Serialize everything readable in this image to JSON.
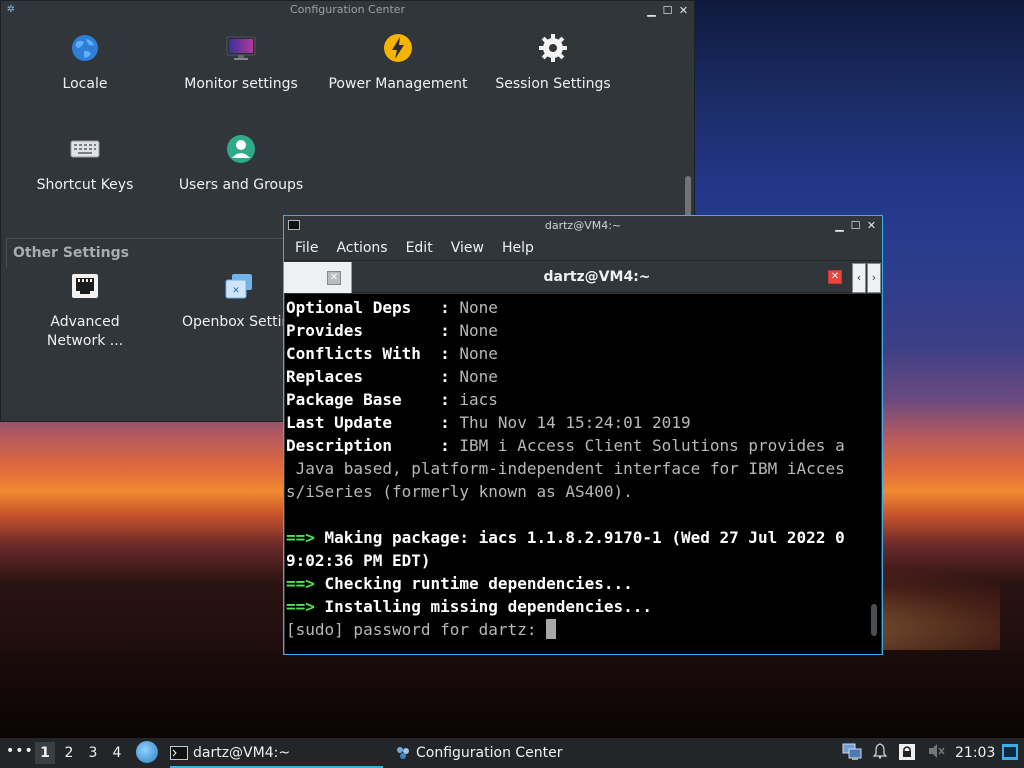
{
  "config_center": {
    "title": "Configuration Center",
    "items": [
      {
        "label": "Locale",
        "icon": "globe-icon"
      },
      {
        "label": "Monitor settings",
        "icon": "monitor-icon"
      },
      {
        "label": "Power Management",
        "icon": "power-icon"
      },
      {
        "label": "Session Settings",
        "icon": "gear-icon"
      },
      {
        "label": "Shortcut Keys",
        "icon": "keyboard-icon"
      },
      {
        "label": "Users and Groups",
        "icon": "user-icon"
      }
    ],
    "other_section_title": "Other Settings",
    "other_items": [
      {
        "label": "Advanced\nNetwork ...",
        "icon": "network-icon"
      },
      {
        "label": "Openbox Settin",
        "icon": "openbox-icon"
      }
    ]
  },
  "terminal": {
    "title": "dartz@VM4:~",
    "menus": [
      "File",
      "Actions",
      "Edit",
      "View",
      "Help"
    ],
    "tab_title": "dartz@VM4:~",
    "lines": [
      {
        "key": "Optional Deps   ",
        "sep": ": ",
        "value": "None"
      },
      {
        "key": "Provides        ",
        "sep": ": ",
        "value": "None"
      },
      {
        "key": "Conflicts With  ",
        "sep": ": ",
        "value": "None"
      },
      {
        "key": "Replaces        ",
        "sep": ": ",
        "value": "None"
      },
      {
        "key": "Package Base    ",
        "sep": ": ",
        "value": "iacs"
      },
      {
        "key": "Last Update     ",
        "sep": ": ",
        "value": "Thu Nov 14 15:24:01 2019"
      },
      {
        "key": "Description     ",
        "sep": ": ",
        "value": "IBM i Access Client Solutions provides a"
      }
    ],
    "desc_cont_1": " Java based, platform-independent interface for IBM iAcces",
    "desc_cont_2": "s/iSeries (formerly known as AS400).",
    "arrow": "==>",
    "msg_making_1": " Making package: iacs 1.1.8.2.9170-1 (Wed 27 Jul 2022 0",
    "msg_making_2": "9:02:36 PM EDT)",
    "msg_checking": " Checking runtime dependencies...",
    "msg_installing": " Installing missing dependencies...",
    "prompt": "[sudo] password for dartz: "
  },
  "taskbar": {
    "menu": "•••",
    "workspaces": [
      "1",
      "2",
      "3",
      "4"
    ],
    "active_workspace": "1",
    "tasks": [
      {
        "label": "dartz@VM4:~",
        "icon": "terminal-icon",
        "active": true
      },
      {
        "label": "Configuration Center",
        "icon": "config-icon",
        "active": false
      }
    ],
    "clock": "21:03"
  },
  "colors": {
    "accent": "#3daee9",
    "panel": "#31363b",
    "terminal_green": "#4ee44e"
  }
}
